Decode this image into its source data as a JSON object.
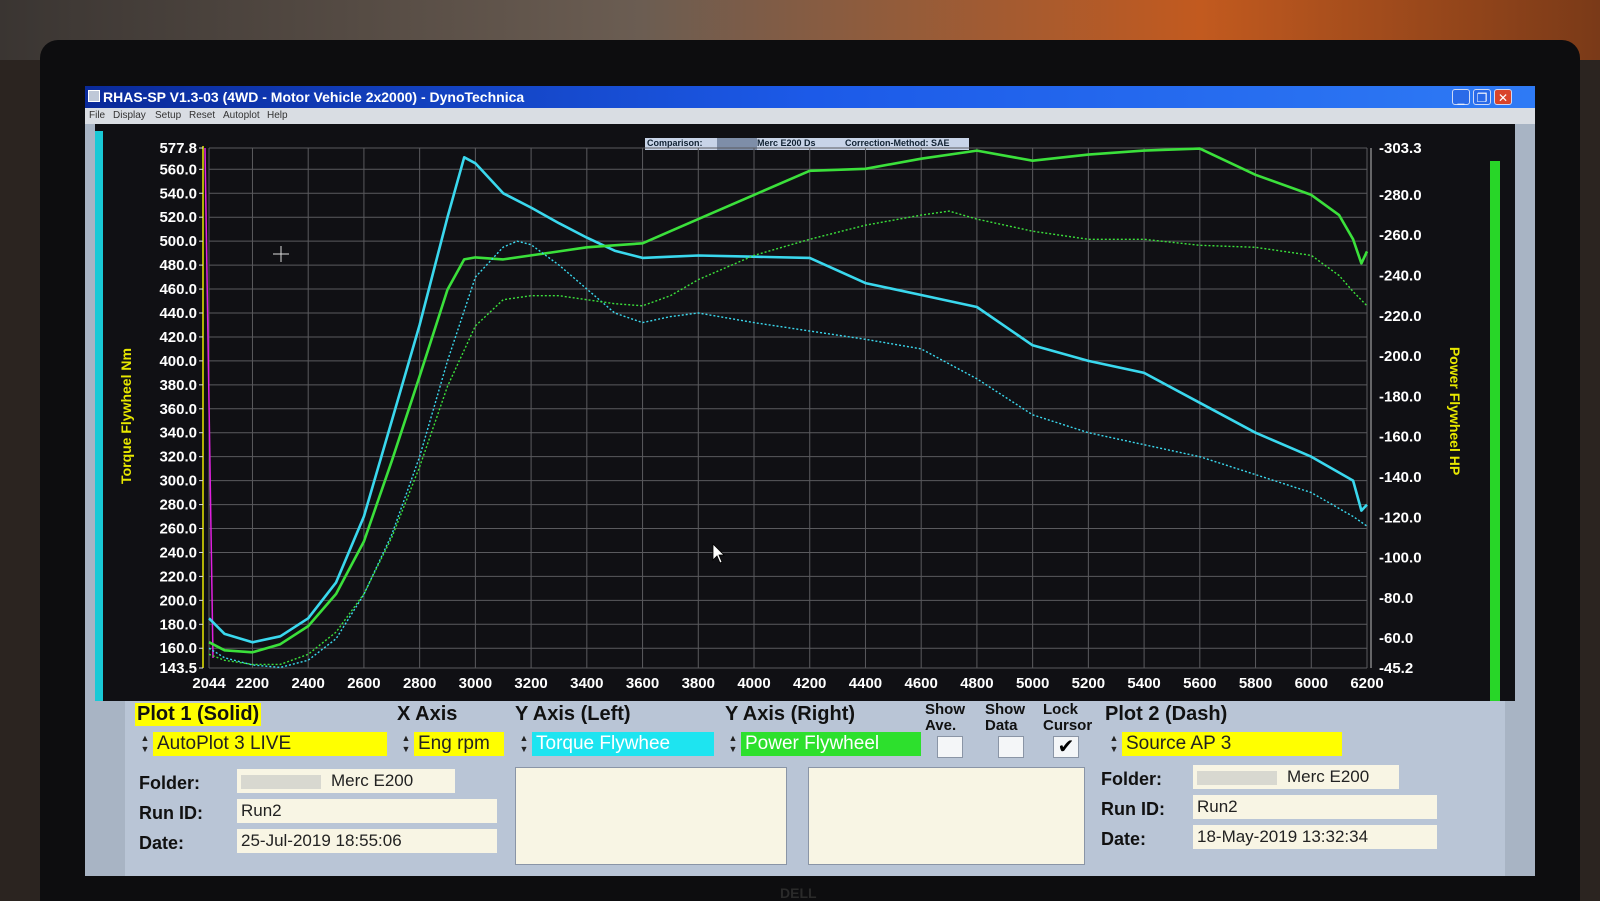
{
  "window": {
    "title": "RHAS-SP V1.3-03  (4WD - Motor Vehicle 2x2000) - DynoTechnica",
    "menu": [
      "File",
      "Display",
      "Setup",
      "Reset",
      "Autoplot",
      "Help"
    ],
    "buttons": {
      "minimize": "_",
      "maximize": "❐",
      "close": "✕"
    }
  },
  "info_bar": {
    "comparison_label": "Comparison:",
    "comparison_value": "Merc E200 Ds",
    "correction": "Correction-Method: SAE"
  },
  "colors": {
    "torque": "#3ad8ee",
    "power": "#3be03b",
    "left_axis": "#e8e800",
    "right_axis": "#e8e800",
    "marker": "#e020e0"
  },
  "chart_data": {
    "type": "line",
    "x_axis": {
      "range": [
        2044,
        6200
      ],
      "ticks": [
        "2044",
        "2200",
        "2400",
        "2600",
        "2800",
        "3000",
        "3200",
        "3400",
        "3600",
        "3800",
        "4000",
        "4200",
        "4400",
        "4600",
        "4800",
        "5000",
        "5200",
        "5400",
        "5600",
        "5800",
        "6000",
        "6200"
      ]
    },
    "y_left": {
      "label": "Torque Flywheel Nm",
      "range": [
        143.5,
        577.8
      ],
      "ticks": [
        "577.8",
        "560.0",
        "540.0",
        "520.0",
        "500.0",
        "480.0",
        "460.0",
        "440.0",
        "420.0",
        "400.0",
        "380.0",
        "360.0",
        "340.0",
        "320.0",
        "300.0",
        "280.0",
        "260.0",
        "240.0",
        "220.0",
        "200.0",
        "180.0",
        "160.0",
        "143.5"
      ]
    },
    "y_right": {
      "label": "Power Flywheel HP",
      "range": [
        45.2,
        303.3
      ],
      "ticks": [
        "303.3",
        "280.0",
        "260.0",
        "240.0",
        "220.0",
        "200.0",
        "180.0",
        "160.0",
        "140.0",
        "120.0",
        "100.0",
        "80.0",
        "60.0",
        "45.2"
      ]
    },
    "grid": true,
    "series": [
      {
        "name": "Torque Flywheel",
        "axis": "left",
        "style": "solid",
        "color": "#3ad8ee",
        "x": [
          2044,
          2100,
          2200,
          2300,
          2400,
          2500,
          2600,
          2700,
          2800,
          2900,
          2960,
          3000,
          3100,
          3200,
          3300,
          3400,
          3500,
          3600,
          3700,
          3800,
          4000,
          4200,
          4400,
          4600,
          4800,
          5000,
          5200,
          5400,
          5600,
          5800,
          6000,
          6150,
          6180,
          6200
        ],
        "y": [
          185,
          172,
          165,
          170,
          185,
          215,
          270,
          350,
          430,
          520,
          570,
          565,
          540,
          528,
          515,
          503,
          492,
          486,
          487,
          488,
          487,
          486,
          465,
          455,
          445,
          413,
          400,
          390,
          365,
          340,
          320,
          300,
          275,
          280
        ]
      },
      {
        "name": "Power Flywheel",
        "axis": "right",
        "style": "solid",
        "color": "#3be03b",
        "x": [
          2044,
          2100,
          2200,
          2300,
          2400,
          2500,
          2600,
          2700,
          2800,
          2900,
          2960,
          3000,
          3100,
          3200,
          3300,
          3400,
          3500,
          3600,
          3700,
          3800,
          4000,
          4200,
          4400,
          4600,
          4800,
          5000,
          5200,
          5400,
          5600,
          5800,
          6000,
          6100,
          6150,
          6180,
          6200
        ],
        "y": [
          58,
          54,
          53,
          57,
          66,
          82,
          108,
          148,
          190,
          233,
          248,
          249,
          248,
          250,
          252,
          254,
          255,
          256,
          262,
          268,
          280,
          292,
          293,
          298,
          302,
          297,
          300,
          302,
          303,
          290,
          280,
          270,
          258,
          246,
          252
        ]
      },
      {
        "name": "Torque Flywheel (Plot 2)",
        "axis": "left",
        "style": "dash",
        "color": "#3ad8ee",
        "x": [
          2044,
          2100,
          2200,
          2300,
          2400,
          2500,
          2600,
          2700,
          2800,
          2900,
          3000,
          3100,
          3150,
          3200,
          3300,
          3400,
          3500,
          3600,
          3700,
          3800,
          4000,
          4200,
          4400,
          4600,
          4800,
          5000,
          5200,
          5400,
          5600,
          5800,
          6000,
          6150,
          6200
        ],
        "y": [
          160,
          152,
          146,
          144,
          150,
          168,
          205,
          255,
          320,
          400,
          470,
          495,
          500,
          497,
          480,
          460,
          440,
          432,
          437,
          440,
          432,
          425,
          418,
          410,
          385,
          355,
          340,
          330,
          320,
          305,
          290,
          270,
          262
        ]
      },
      {
        "name": "Power Flywheel (Plot 2)",
        "axis": "right",
        "style": "dash",
        "color": "#3be03b",
        "x": [
          2044,
          2100,
          2200,
          2300,
          2400,
          2500,
          2600,
          2700,
          2800,
          2900,
          3000,
          3100,
          3200,
          3300,
          3400,
          3500,
          3600,
          3700,
          3800,
          4000,
          4200,
          4400,
          4600,
          4700,
          4800,
          5000,
          5200,
          5400,
          5600,
          5800,
          6000,
          6100,
          6150,
          6200
        ],
        "y": [
          52,
          49,
          47,
          47,
          52,
          63,
          82,
          110,
          145,
          185,
          215,
          228,
          230,
          230,
          228,
          226,
          225,
          230,
          238,
          250,
          258,
          265,
          270,
          272,
          268,
          262,
          258,
          258,
          255,
          254,
          250,
          240,
          232,
          225
        ]
      }
    ]
  },
  "panel": {
    "plot1": {
      "header": "Plot 1 (Solid)",
      "source": "AutoPlot 3 LIVE",
      "folder_label": "Folder:",
      "folder_value": "Merc E200",
      "runid_label": "Run ID:",
      "runid_value": "Run2",
      "date_label": "Date:",
      "date_value": "25-Jul-2019  18:55:06"
    },
    "x_axis": {
      "header": "X Axis",
      "value": "Eng rpm"
    },
    "y_left": {
      "header": "Y Axis (Left)",
      "value": "Torque Flywhee"
    },
    "y_right": {
      "header": "Y Axis (Right)",
      "value": "Power Flywheel"
    },
    "checkbox_labels": {
      "show_ave_1": "Show",
      "show_ave_2": "Ave.",
      "show_data_1": "Show",
      "show_data_2": "Data",
      "lock_cursor_1": "Lock",
      "lock_cursor_2": "Cursor"
    },
    "checks": {
      "show_ave": "",
      "show_data": "",
      "lock_cursor": "✔"
    },
    "plot2": {
      "header": "Plot 2 (Dash)",
      "source": "Source AP 3",
      "folder_label": "Folder:",
      "folder_value": "Merc E200",
      "runid_label": "Run ID:",
      "runid_value": "Run2",
      "date_label": "Date:",
      "date_value": "18-May-2019  13:32:34"
    }
  }
}
